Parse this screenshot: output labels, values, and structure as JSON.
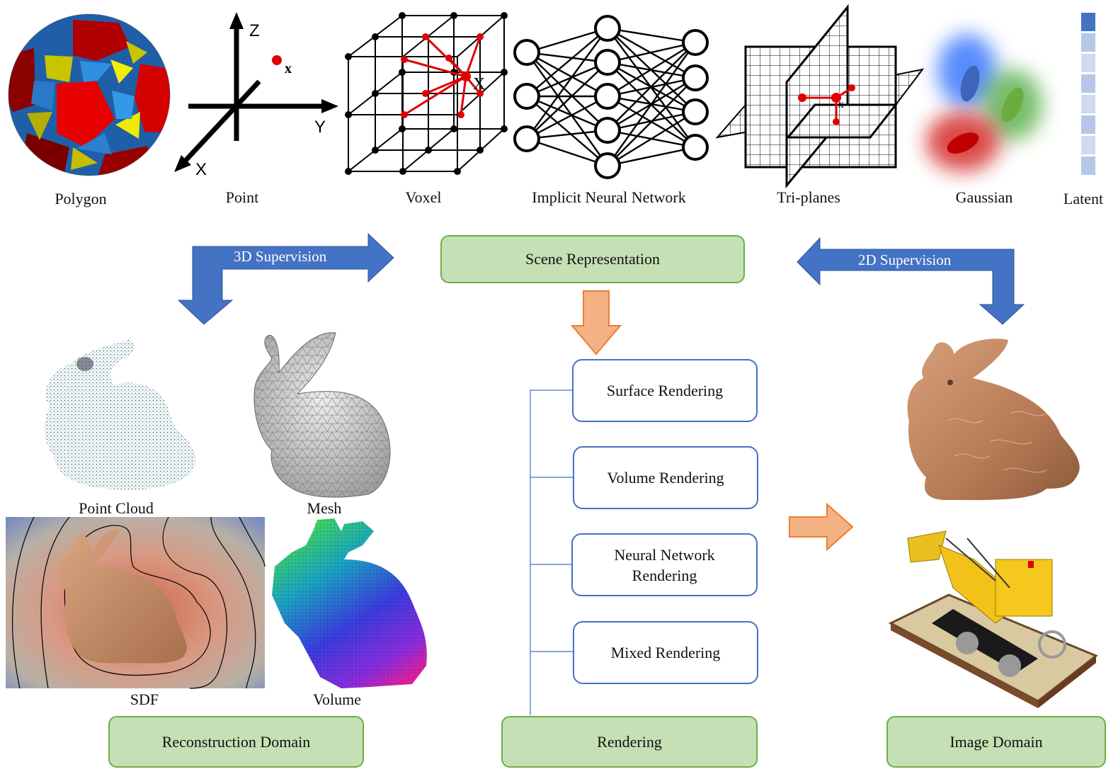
{
  "representations": [
    {
      "label": "Polygon",
      "icon": "polyhedron-icon"
    },
    {
      "label": "Point",
      "icon": "point-axes-icon"
    },
    {
      "label": "Voxel",
      "icon": "voxel-grid-icon"
    },
    {
      "label": "Implicit Neural Network",
      "icon": "neural-network-icon"
    },
    {
      "label": "Tri-planes",
      "icon": "triplanes-icon"
    },
    {
      "label": "Gaussian",
      "icon": "gaussian-blobs-icon"
    },
    {
      "label": "Latent",
      "icon": "latent-vector-icon"
    }
  ],
  "axes": {
    "z": "Z",
    "y": "Y",
    "x": "X",
    "point": "x"
  },
  "voxel_point_label": "X",
  "triplane_point_label": "x",
  "latent_cells": [
    1.0,
    0.3,
    0.15,
    0.3,
    0.15,
    0.3,
    0.15,
    0.3
  ],
  "colors": {
    "green_fill": "#c5e0b4",
    "green_border": "#70ad47",
    "blue_arrow": "#4472c4",
    "orange_arrow": "#f4b183",
    "orange_border": "#ed7d31",
    "render_border": "#4472c4"
  },
  "arrows": {
    "supervision_3d": "3D Supervision",
    "supervision_2d": "2D Supervision"
  },
  "center": {
    "scene_representation": "Scene Representation",
    "rendering_methods": [
      "Surface Rendering",
      "Volume Rendering",
      "Neural Network Rendering",
      "Mixed Rendering"
    ],
    "rendering": "Rendering"
  },
  "reconstruction": {
    "items": [
      {
        "label": "Point Cloud",
        "icon": "point-cloud-bunny-image"
      },
      {
        "label": "Mesh",
        "icon": "mesh-bunny-image"
      },
      {
        "label": "SDF",
        "icon": "sdf-bunny-image"
      },
      {
        "label": "Volume",
        "icon": "voxel-bunny-image"
      }
    ],
    "domain_label": "Reconstruction Domain"
  },
  "image_domain": {
    "items": [
      {
        "icon": "rendered-bunny-image"
      },
      {
        "icon": "lego-bulldozer-image"
      }
    ],
    "domain_label": "Image Domain"
  }
}
